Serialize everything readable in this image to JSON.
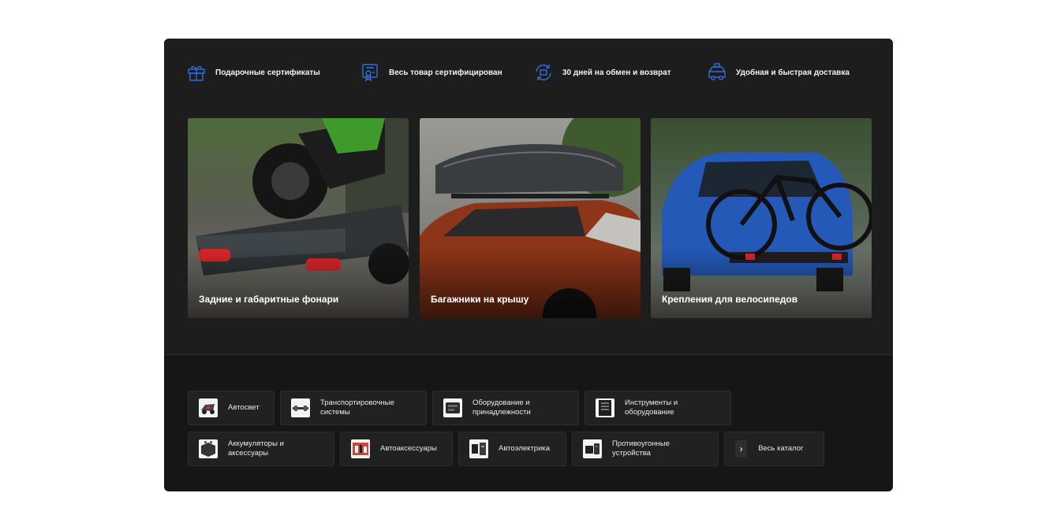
{
  "colors": {
    "accent": "#2f6fe0",
    "panel_bg": "#161616",
    "panel_top_bg": "#1d1d1d",
    "tile_bg": "#212121"
  },
  "features": [
    {
      "icon": "gift-icon",
      "label": "Подарочные сертификаты"
    },
    {
      "icon": "certificate-icon",
      "label": "Весь товар сертифицирован"
    },
    {
      "icon": "exchange-icon",
      "label": "30 дней на обмен и возврат"
    },
    {
      "icon": "delivery-truck-icon",
      "label": "Удобная и быстрая доставка"
    }
  ],
  "promo_cards": [
    {
      "title": "Задние и габаритные фонари",
      "image": "motorcycle-trailer-image"
    },
    {
      "title": "Багажники на крышу",
      "image": "roof-box-car-image"
    },
    {
      "title": "Крепления для велосипедов",
      "image": "bike-rack-car-image"
    }
  ],
  "categories": [
    {
      "label": "Автосвет"
    },
    {
      "label": "Транспортировочные системы"
    },
    {
      "label": "Оборудование и принадлежности"
    },
    {
      "label": "Инструменты и оборудование"
    },
    {
      "label": "Аккумуляторы и аксессуары"
    },
    {
      "label": "Автоаксессуары"
    },
    {
      "label": "Автоэлектрика"
    },
    {
      "label": "Противоугонные устройства"
    }
  ],
  "all_catalog": {
    "label": "Весь каталог",
    "icon": "chevron-right-icon",
    "glyph": "›"
  }
}
